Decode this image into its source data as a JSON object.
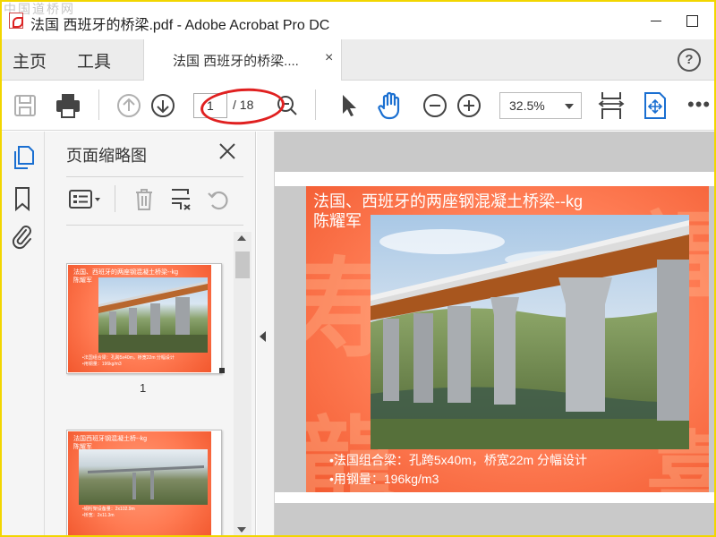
{
  "window": {
    "title": "法国 西班牙的桥梁.pdf - Adobe Acrobat Pro DC",
    "watermark": "中国道桥网"
  },
  "menu": {
    "home": "主页",
    "tools": "工具"
  },
  "doc_tab": {
    "label": "法国 西班牙的桥梁....",
    "close": "×"
  },
  "help": {
    "label": "?"
  },
  "toolbar": {
    "current_page": "1",
    "page_total": "/ 18",
    "zoom": "32.5%",
    "more": "•••"
  },
  "thumbnails_panel": {
    "title": "页面缩略图",
    "pages": [
      {
        "number": "1",
        "title_line1": "法国、西班牙的两座钢混凝土桥梁--kg",
        "title_line2": "陈耀军",
        "bullet1": "•法国组合梁：孔跨5x40m，桥宽22m 分幅设计",
        "bullet2": "•用钢量：196kg/m3"
      },
      {
        "title_line1": "法国西班牙钢混凝土桥--kg",
        "title_line2": "陈耀军",
        "bullet1": "•钢桁架设备量：2x102.9m",
        "bullet2": "•桥宽：2x11.3m"
      }
    ]
  },
  "slide": {
    "title_line1": "法国、西班牙的两座钢混凝土桥梁--kg",
    "title_line2": "陈耀军",
    "bullet1": "•法国组合梁：孔跨5x40m，桥宽22m 分幅设计",
    "bullet2": "•用钢量：196kg/m3"
  },
  "colors": {
    "accent_blue": "#1a6fd1",
    "annotation_red": "#e02020",
    "slide_orange": "#ff7e56",
    "window_border": "#f2d600"
  }
}
